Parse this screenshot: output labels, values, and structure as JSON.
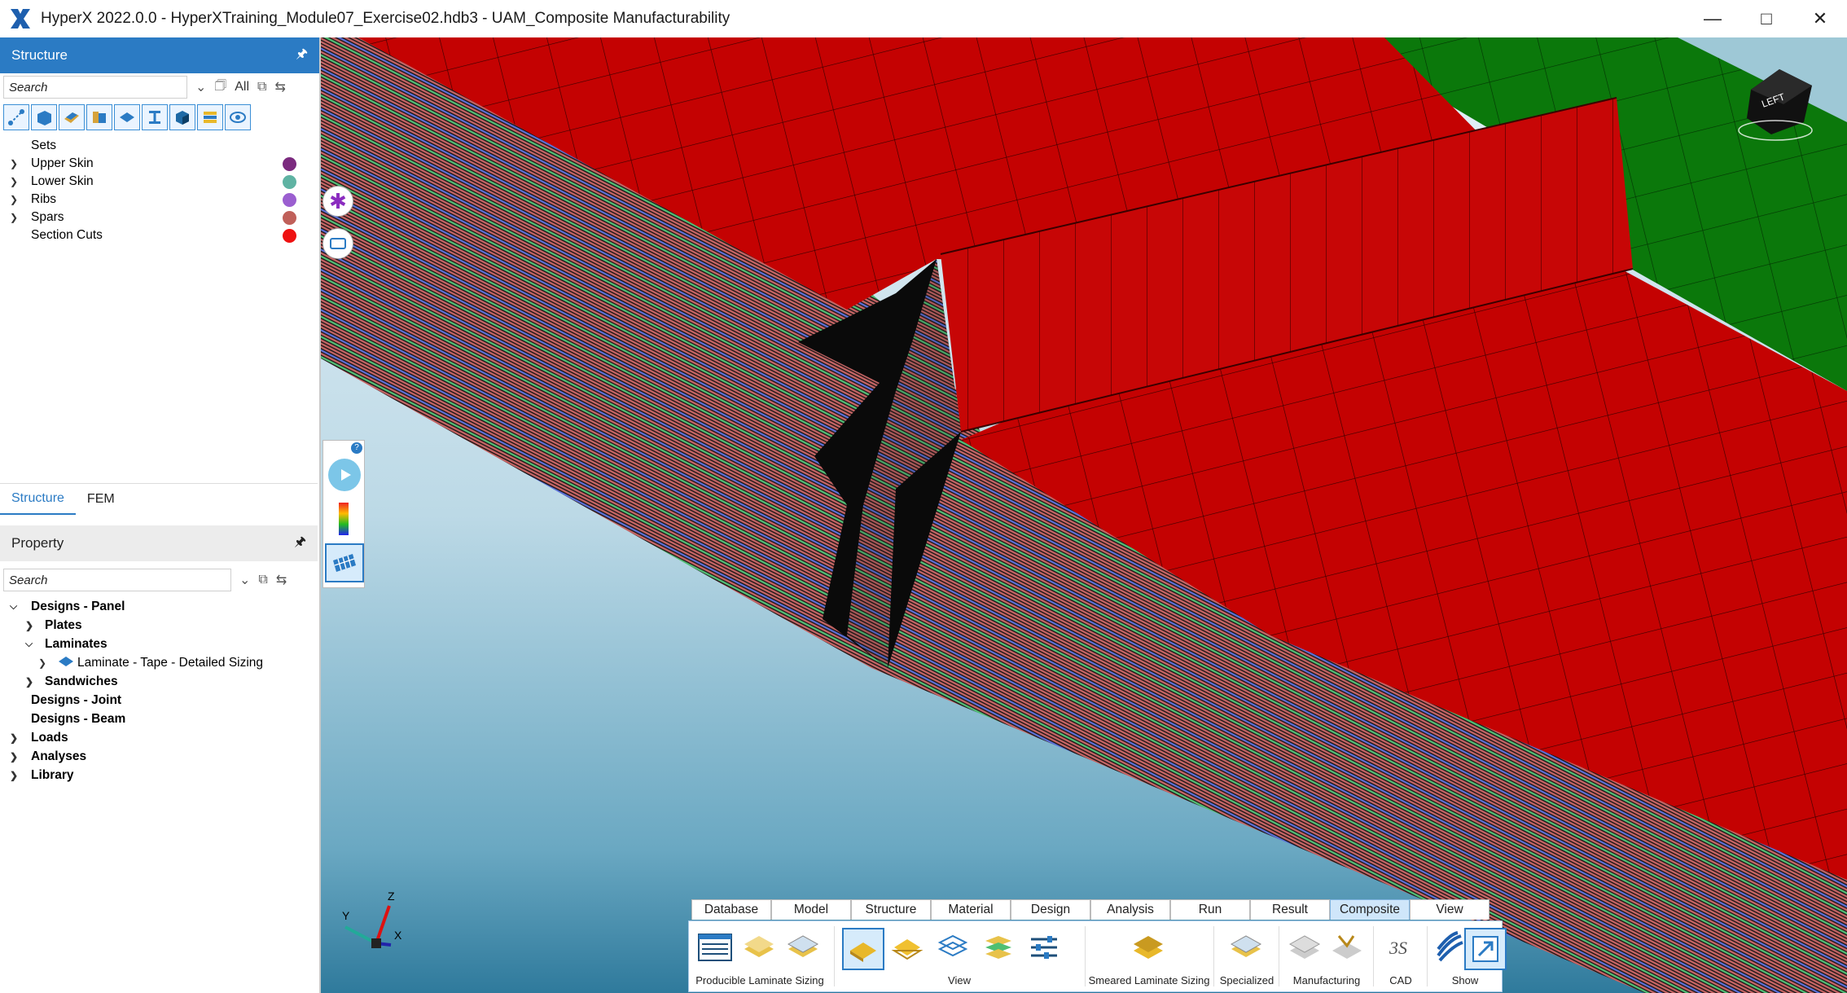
{
  "window": {
    "title": "HyperX 2022.0.0 - HyperXTraining_Module07_Exercise02.hdb3 - UAM_Composite Manufacturability",
    "minimize": "—",
    "maximize": "□",
    "close": "✕"
  },
  "structure_panel": {
    "header": "Structure",
    "search_placeholder": "Search",
    "all_label": "All",
    "tree": [
      {
        "label": "Sets",
        "color": ""
      },
      {
        "label": "Upper Skin",
        "color": "#7b2a7f"
      },
      {
        "label": "Lower Skin",
        "color": "#5fb3a3"
      },
      {
        "label": "Ribs",
        "color": "#9b5fd0"
      },
      {
        "label": "Spars",
        "color": "#c0605a"
      },
      {
        "label": "Section Cuts",
        "color": "#ee1111"
      }
    ],
    "tabs": [
      "Structure",
      "FEM"
    ]
  },
  "property_panel": {
    "header": "Property",
    "search_placeholder": "Search",
    "tree": [
      {
        "label": "Designs - Panel"
      },
      {
        "label": "Plates"
      },
      {
        "label": "Laminates"
      },
      {
        "label": "Laminate - Tape - Detailed Sizing"
      },
      {
        "label": "Sandwiches"
      },
      {
        "label": "Designs - Joint"
      },
      {
        "label": "Designs - Beam"
      },
      {
        "label": "Loads"
      },
      {
        "label": "Analyses"
      },
      {
        "label": "Library"
      }
    ]
  },
  "viewcube": {
    "face_label": "LEFT"
  },
  "axes": {
    "x": "X",
    "y": "Y",
    "z": "Z"
  },
  "ribbon": {
    "tabs": [
      "Database",
      "Model",
      "Structure",
      "Material",
      "Design",
      "Analysis",
      "Run",
      "Result",
      "Composite",
      "View"
    ],
    "active_tab": "Composite",
    "groups": [
      "Producible Laminate Sizing",
      "View",
      "Smeared Laminate Sizing",
      "Specialized",
      "Manufacturing",
      "CAD",
      "Show"
    ]
  },
  "colors": {
    "accent": "#2b7bc4",
    "mesh_red": "#c40000",
    "mesh_green": "#0e7a0e",
    "ply_red": "#c66060",
    "ply_blue": "#5a72d6",
    "ply_green": "#4fbf72"
  }
}
